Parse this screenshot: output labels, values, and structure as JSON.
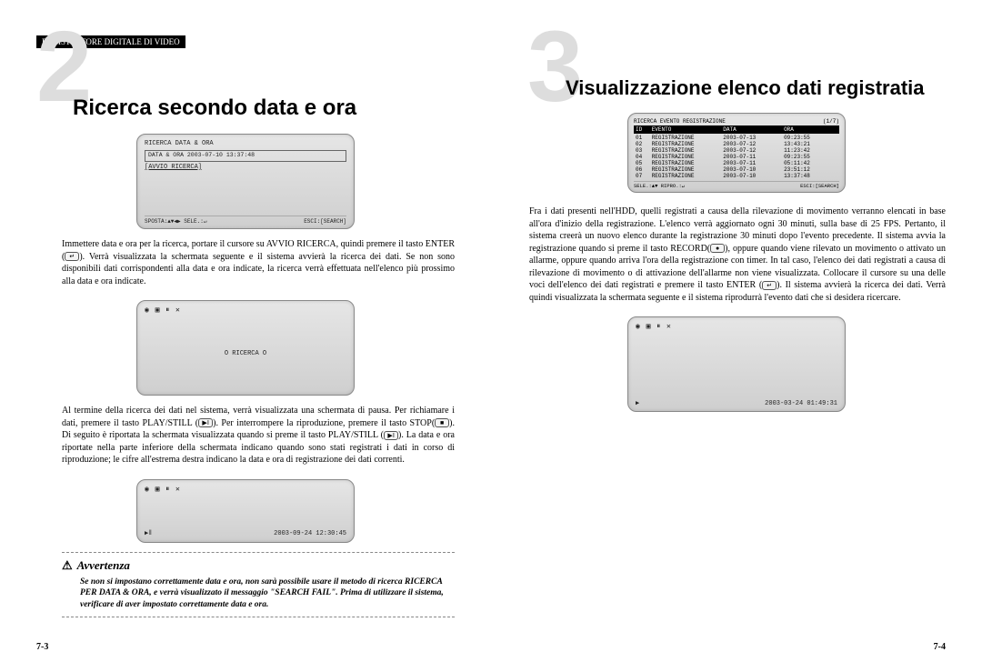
{
  "header": "REGISTRATORE DIGITALE DI VIDEO",
  "left": {
    "num": "2",
    "title": "Ricerca secondo data e ora",
    "screen1": {
      "t": "RICERCA DATA & ORA",
      "line": "DATA & ORA  2003-07-10 13:37:48",
      "link": "[AVVIO RICERCA]",
      "bl": "SPOSTA:▲▼◀▶ SELE.:↵",
      "br": "ESCI:[SEARCH]"
    },
    "p1": "Immettere data e ora per la ricerca, portare il cursore su AVVIO RICERCA, quindi premere il tasto ENTER (",
    "p1b": "). Verrà visualizzata la schermata seguente e il sistema avvierà la ricerca dei dati. Se non sono disponibili dati corrispondenti alla data e ora indicate, la ricerca verrà effettuata nell'elenco più prossimo alla data e ora indicate.",
    "screen2": {
      "icons": "◉ ▣ ⏸ ✕",
      "mid": "O RICERCA O"
    },
    "p2": "Al termine della ricerca dei dati nel sistema, verrà visualizzata una schermata di pausa. Per richiamare i dati, premere il tasto PLAY/STILL (",
    "p2b": "). Per interrompere la riproduzione, premere il tasto STOP(",
    "p2c": "). Di seguito è riportata la schermata visualizzata quando si preme il tasto PLAY/STILL (",
    "p2d": "). La data e ora riportate nella parte inferiore della schermata indicano quando sono stati registrati i dati in corso di riproduzione; le cifre all'estrema destra indicano la data e ora di registrazione dei dati correnti.",
    "screen3": {
      "icons": "◉ ▣ ⏸ ✕",
      "pbl": "▶ǁ",
      "ts": "2003-09-24 12:30:45"
    },
    "warn_t": "Avvertenza",
    "warn_b": "Se non si impostano correttamente data e ora, non sarà possibile usare il metodo di ricerca RICERCA PER DATA & ORA, e verrà visualizzato il messaggio \"SEARCH FAIL\". Prima di utilizzare il sistema, verificare di aver impostato correttamente data e ora.",
    "pg": "7-3"
  },
  "right": {
    "num": "3",
    "title": "Visualizzazione elenco dati registratia",
    "tbl": {
      "t": "RICERCA EVENTO REGISTRAZIONE",
      "pg": "(1/7)",
      "h": [
        "ID",
        "EVENTO",
        "DATA",
        "ORA"
      ],
      "rows": [
        [
          "01",
          "REGISTRAZIONE",
          "2003-07-13",
          "09:23:55"
        ],
        [
          "02",
          "REGISTRAZIONE",
          "2003-07-12",
          "13:43:21"
        ],
        [
          "03",
          "REGISTRAZIONE",
          "2003-07-12",
          "11:23:42"
        ],
        [
          "04",
          "REGISTRAZIONE",
          "2003-07-11",
          "09:23:55"
        ],
        [
          "05",
          "REGISTRAZIONE",
          "2003-07-11",
          "05:11:42"
        ],
        [
          "06",
          "REGISTRAZIONE",
          "2003-07-10",
          "23:51:12"
        ],
        [
          "07",
          "REGISTRAZIONE",
          "2003-07-10",
          "13:37:48"
        ]
      ],
      "bl": "SELE.:▲▼ RIPRO.:↵",
      "br": "ESCI:[SEARCH]"
    },
    "p1": "Fra i dati presenti nell'HDD, quelli registrati a causa della rilevazione di movimento verranno elencati in base all'ora d'inizio della registrazione. L'elenco verrà aggiornato ogni 30 minuti, sulla base di 25 FPS. Pertanto, il sistema creerà un nuovo elenco durante la registrazione 30 minuti dopo l'evento precedente. Il sistema avvia la registrazione quando si preme il tasto RECORD(",
    "p1b": "), oppure quando viene rilevato un movimento o attivato un allarme, oppure quando arriva l'ora della registrazione con timer. In tal caso, l'elenco dei dati registrati a causa di rilevazione di movimento o di attivazione dell'allarme non viene visualizzata. Collocare il cursore su una delle voci dell'elenco dei dati registrati e premere il tasto ENTER (",
    "p1c": "). Il sistema avvierà la ricerca dei dati. Verrà quindi visualizzata la schermata seguente e il sistema riprodurrà l'evento dati che si desidera ricercare.",
    "screen": {
      "icons": "◉ ▣ ⏸ ✕",
      "pbl": "▶",
      "ts": "2003-03-24  01:49:31"
    },
    "pg": "7-4"
  }
}
